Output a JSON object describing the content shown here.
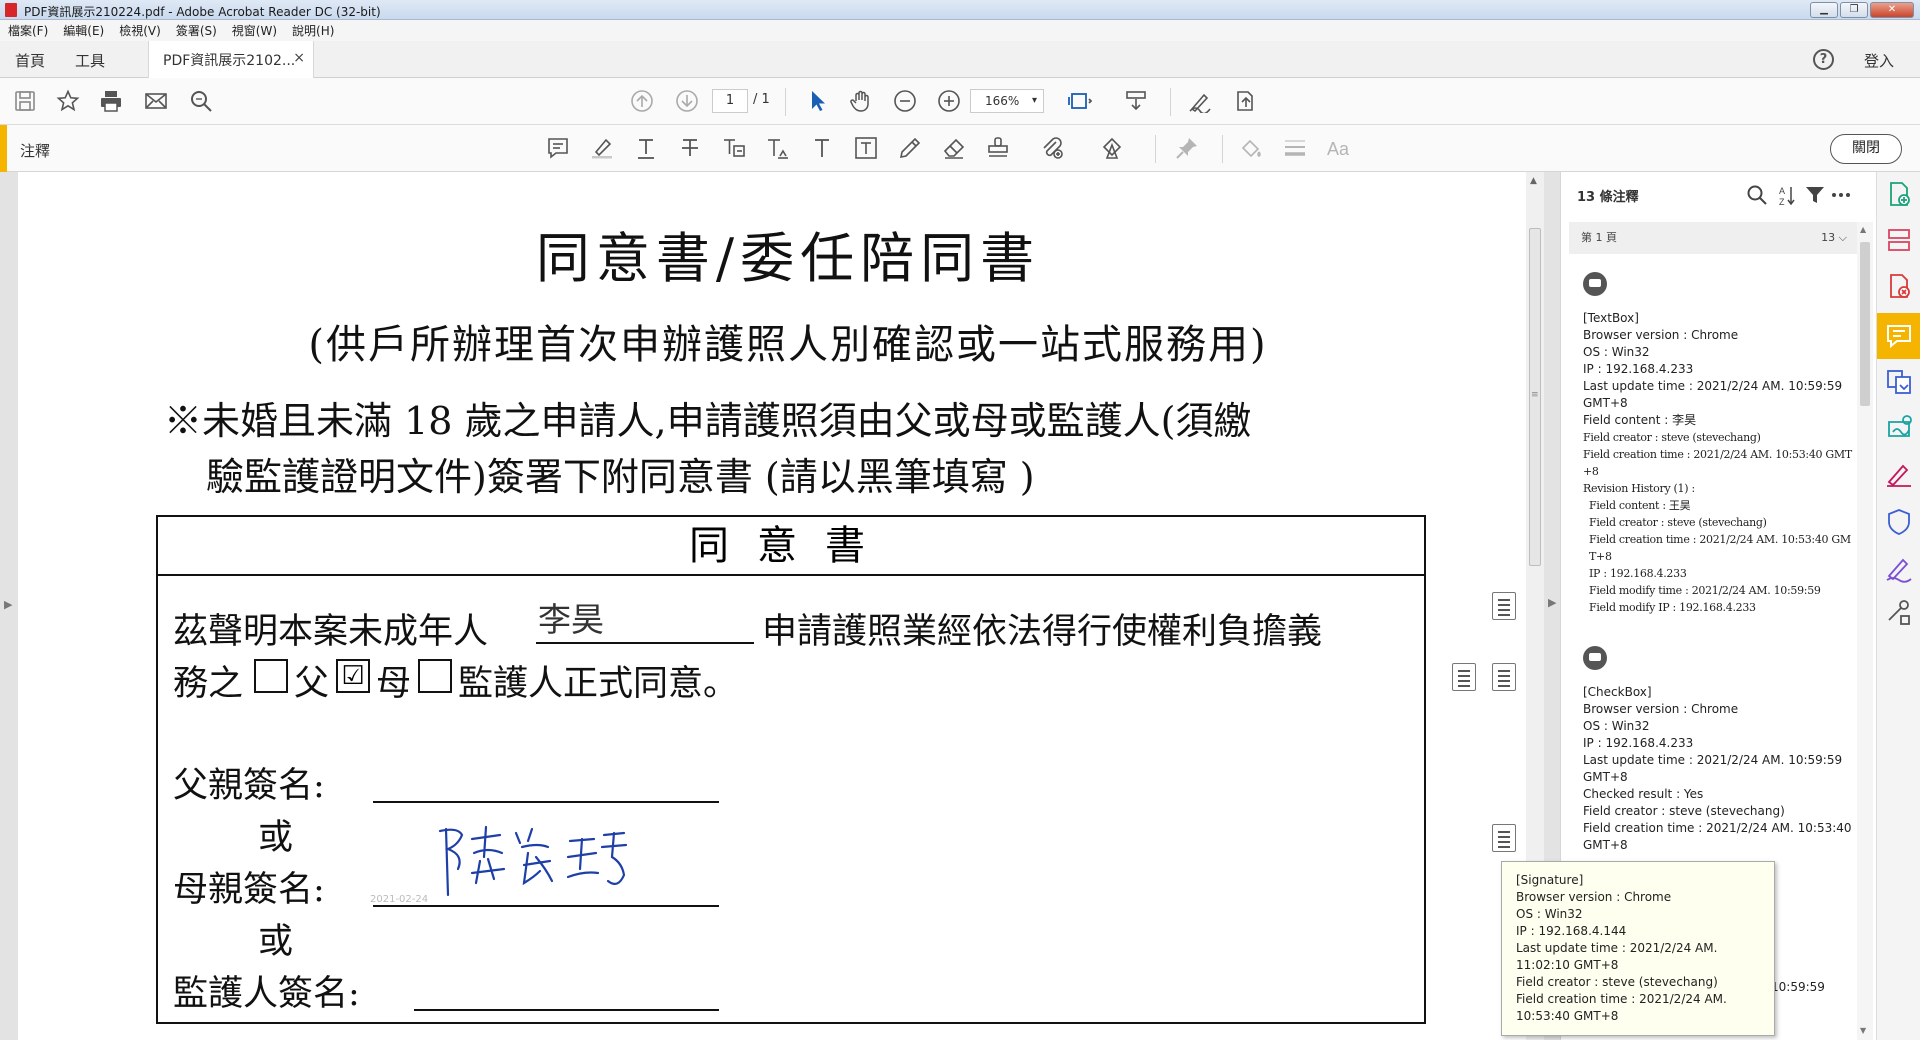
{
  "window": {
    "title": "PDF資訊展示210224.pdf - Adobe Acrobat Reader DC (32-bit)",
    "buttons": [
      "▁",
      "❐",
      "✕"
    ]
  },
  "menu": [
    "檔案(F)",
    "編輯(E)",
    "檢視(V)",
    "簽署(S)",
    "視窗(W)",
    "說明(H)"
  ],
  "tabs": {
    "home": "首頁",
    "tools": "工具",
    "document": "PDF資訊展示2102...",
    "close": "×",
    "help": "?",
    "login": "登入"
  },
  "toolbar": {
    "page_current": "1",
    "page_total": "/ 1",
    "zoom": "166%",
    "zoom_caret": "▾"
  },
  "comment_bar": {
    "label": "注釋",
    "close_label": "關閉"
  },
  "document": {
    "title": "同意書/委任陪同書",
    "subtitle": "(供戶所辦理首次申辦護照人別確認或一站式服務用)",
    "notice_line1": "※未婚且未滿 18 歲之申請人,申請護照須由父或母或監護人(須繳",
    "notice_line2": "驗監護證明文件)簽署下附同意書 (請以黑筆填寫 )",
    "consent_heading": "同意書",
    "body_prefix": "茲聲明本案未成年人",
    "minor_name": "李昊",
    "body_suffix": "申請護照業經依法得行使權利負擔義",
    "line2_prefix": "務之",
    "father_label": "父",
    "mother_label": "母",
    "guardian_label": "監護人正式同意。",
    "checkbox_father": "",
    "checkbox_mother": "☑",
    "checkbox_guardian": "",
    "father_sign": "父親簽名:",
    "or1": "或",
    "mother_sign": "母親簽名:",
    "or2": "或",
    "guardian_sign": "監護人簽名:",
    "signature_date": "2021-02-24"
  },
  "comments_pane": {
    "header": "13 條注釋",
    "page_group": "第 1 頁",
    "page_count": "13",
    "page_caret": "⌵",
    "entries": [
      {
        "lines": [
          "[TextBox]",
          "Browser version : Chrome",
          "OS : Win32",
          "IP : 192.168.4.233",
          "Last update time : 2021/2/24 AM. 10:59:59 GMT+8",
          "Field content : 李昊"
        ],
        "serif_lines": [
          "Field creator : steve (stevechang)",
          "Field creation time : 2021/2/24 AM. 10:53:40 GMT+8",
          "Revision History (1) :"
        ],
        "history_lines": [
          "Field content : 王昊",
          "Field creator : steve (stevechang)",
          "Field creation time : 2021/2/24 AM. 10:53:40 GMT+8",
          "IP : 192.168.4.233",
          "Field modify time : 2021/2/24 AM. 10:59:59",
          "Field modify IP : 192.168.4.233"
        ]
      },
      {
        "lines": [
          "[CheckBox]",
          "Browser version : Chrome",
          "OS : Win32",
          "IP : 192.168.4.233",
          "Last update time : 2021/2/24 AM. 10:59:59 GMT+8",
          "Checked result : Yes",
          "Field creator : steve (stevechang)",
          "Field creation time : 2021/2/24 AM. 10:53:40 GMT+8"
        ]
      }
    ],
    "partial_text": "10:59:59"
  },
  "tooltip": {
    "lines": [
      "[Signature]",
      "Browser version : Chrome",
      "OS : Win32",
      "IP : 192.168.4.144",
      "Last update time : 2021/2/24 AM.",
      "11:02:10 GMT+8",
      "Field creator : steve (stevechang)",
      "Field creation time : 2021/2/24 AM.",
      "10:53:40 GMT+8"
    ]
  },
  "colors": {
    "accent": "#f4b400",
    "tool_blue": "#1a5fb4",
    "signature_ink": "#1f3fa8"
  }
}
